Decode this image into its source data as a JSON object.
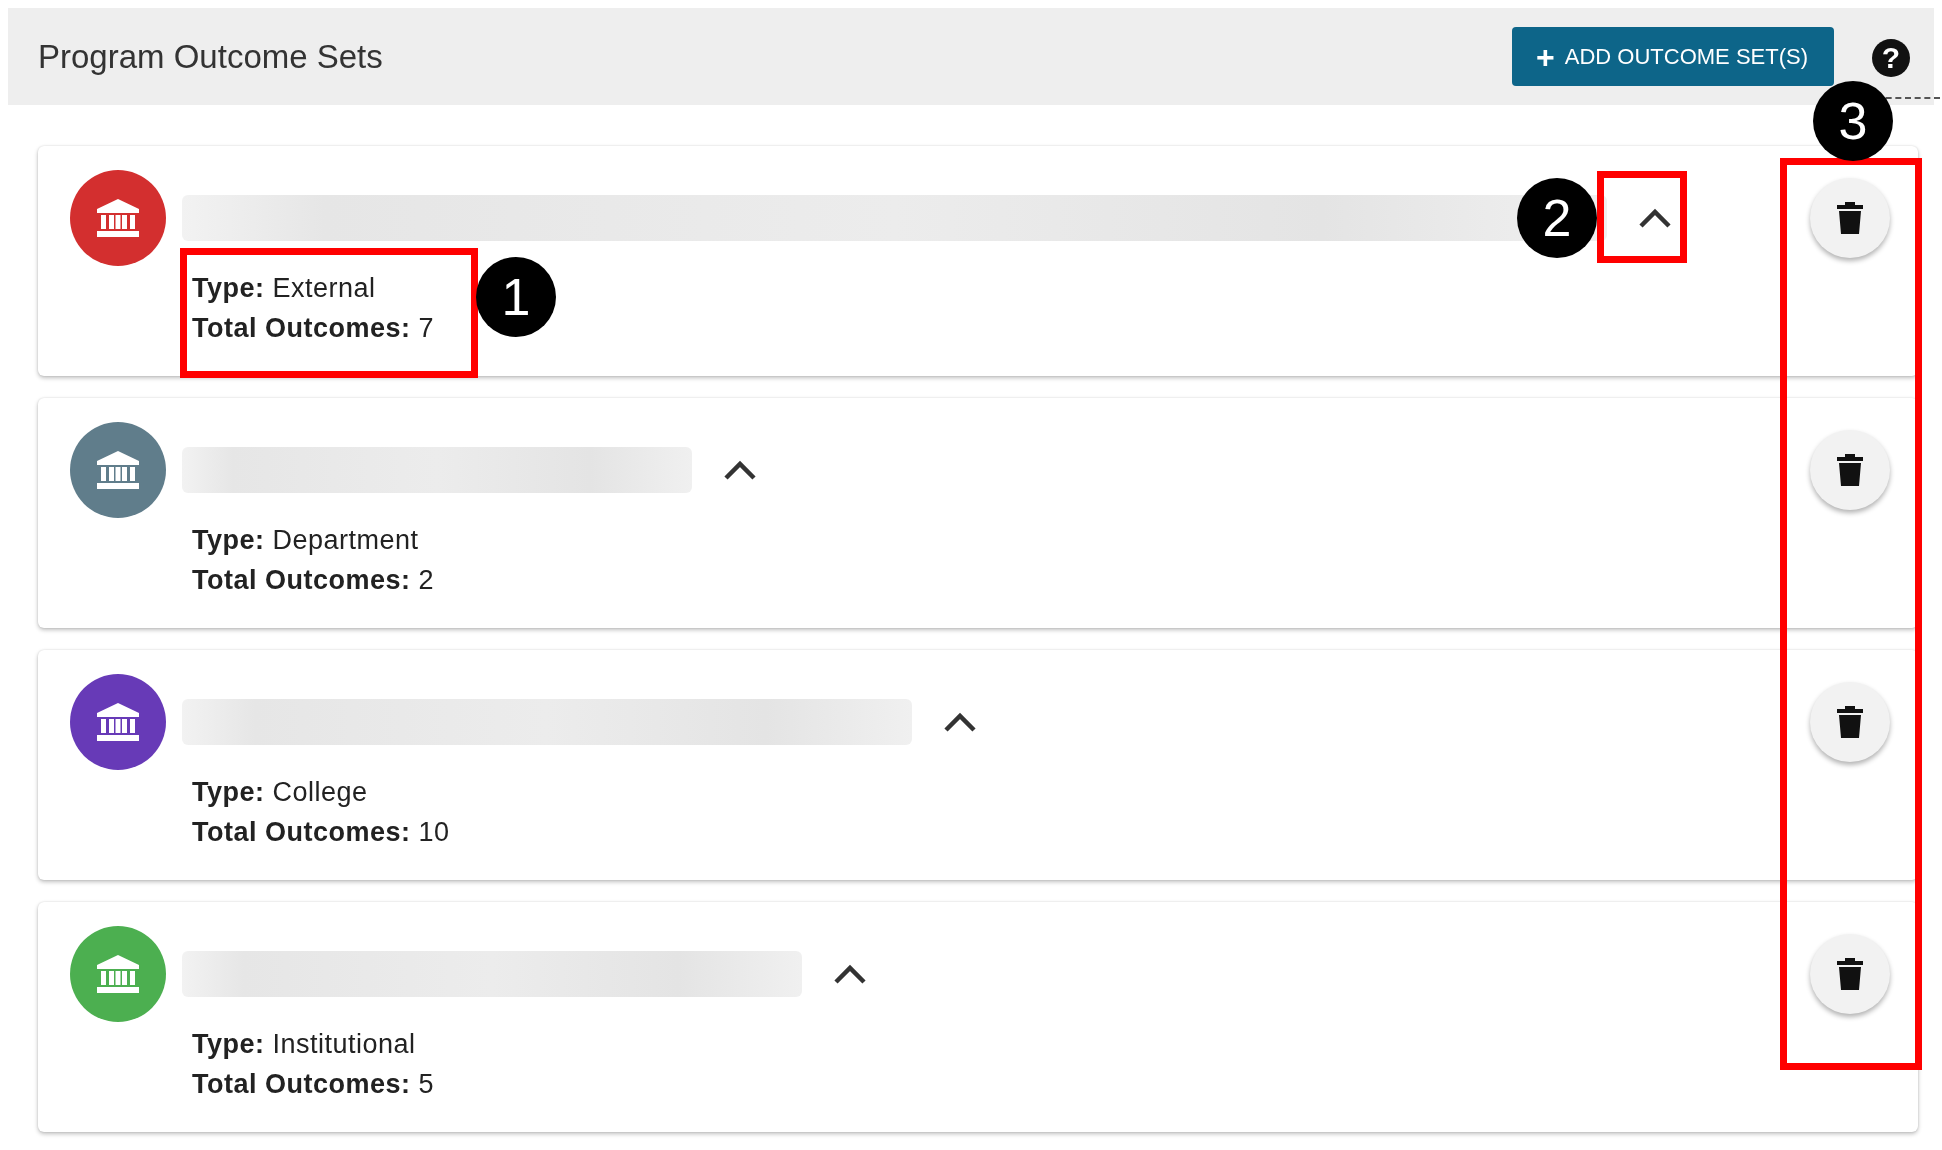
{
  "header": {
    "title": "Program Outcome Sets",
    "add_button": {
      "icon": "+",
      "label": "ADD OUTCOME SET(S)"
    },
    "help": "?"
  },
  "outcome_sets": [
    {
      "color": "#d32f2f",
      "type_label": "Type:",
      "type": "External",
      "total_label": "Total Outcomes:",
      "total": "7",
      "expanded": true
    },
    {
      "color": "#607d8b",
      "type_label": "Type:",
      "type": "Department",
      "total_label": "Total Outcomes:",
      "total": "2",
      "expanded": true
    },
    {
      "color": "#673ab7",
      "type_label": "Type:",
      "type": "College",
      "total_label": "Total Outcomes:",
      "total": "10",
      "expanded": true
    },
    {
      "color": "#4caf50",
      "type_label": "Type:",
      "type": "Institutional",
      "total_label": "Total Outcomes:",
      "total": "5",
      "expanded": true
    }
  ],
  "annotations": [
    {
      "label": "1"
    },
    {
      "label": "2"
    },
    {
      "label": "3"
    }
  ]
}
